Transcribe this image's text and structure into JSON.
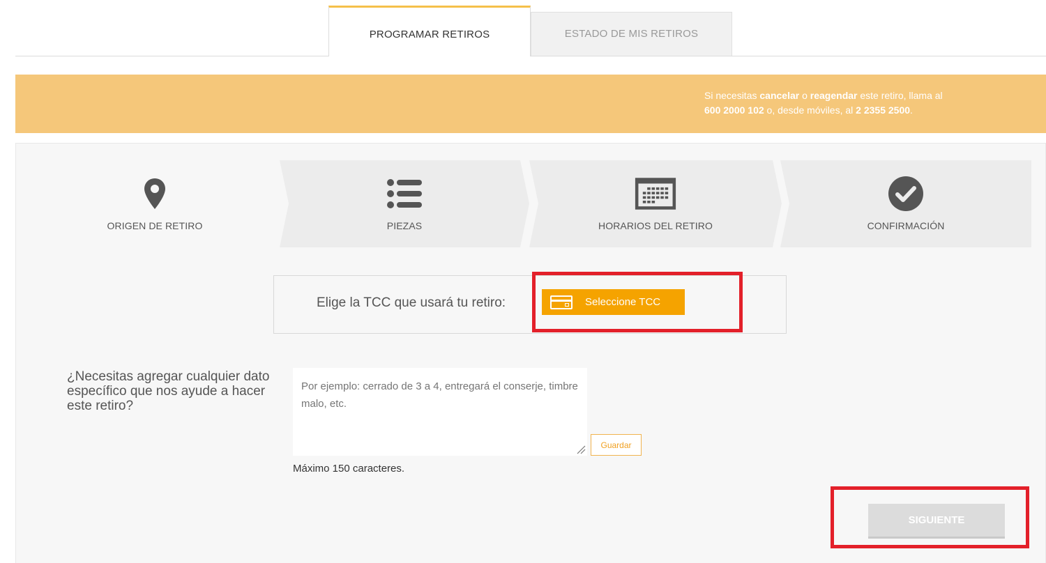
{
  "tabs": [
    {
      "label": "PROGRAMAR RETIROS",
      "active": true
    },
    {
      "label": "ESTADO DE MIS RETIROS",
      "active": false
    }
  ],
  "banner": {
    "part1": "Si necesitas ",
    "bold1": "cancelar",
    "part2": " o ",
    "bold2": "reagendar",
    "part3": " este retiro, llama al ",
    "bold3": "600 2000 102",
    "part4": " o, desde móviles, al ",
    "bold4": "2 2355 2500",
    "part5": "."
  },
  "steps": [
    {
      "label": "ORIGEN DE RETIRO",
      "icon": "map-pin-icon"
    },
    {
      "label": "PIEZAS",
      "icon": "list-icon"
    },
    {
      "label": "HORARIOS DEL RETIRO",
      "icon": "calendar-icon"
    },
    {
      "label": "CONFIRMACIÓN",
      "icon": "check-circle-icon"
    }
  ],
  "tcc": {
    "label": "Elige la TCC que usará tu retiro:",
    "button_label": "Seleccione TCC"
  },
  "notes": {
    "question": "¿Necesitas agregar cualquier dato específico que nos ayude a hacer este retiro?",
    "placeholder": "Por ejemplo: cerrado de 3 a 4, entregará el conserje, timbre malo, etc.",
    "save_label": "Guardar",
    "max_chars": "Máximo 150 caracteres."
  },
  "next_label": "SIGUIENTE",
  "colors": {
    "accent": "#f5a300",
    "banner": "#f5c77a",
    "highlight": "#e3202a"
  }
}
